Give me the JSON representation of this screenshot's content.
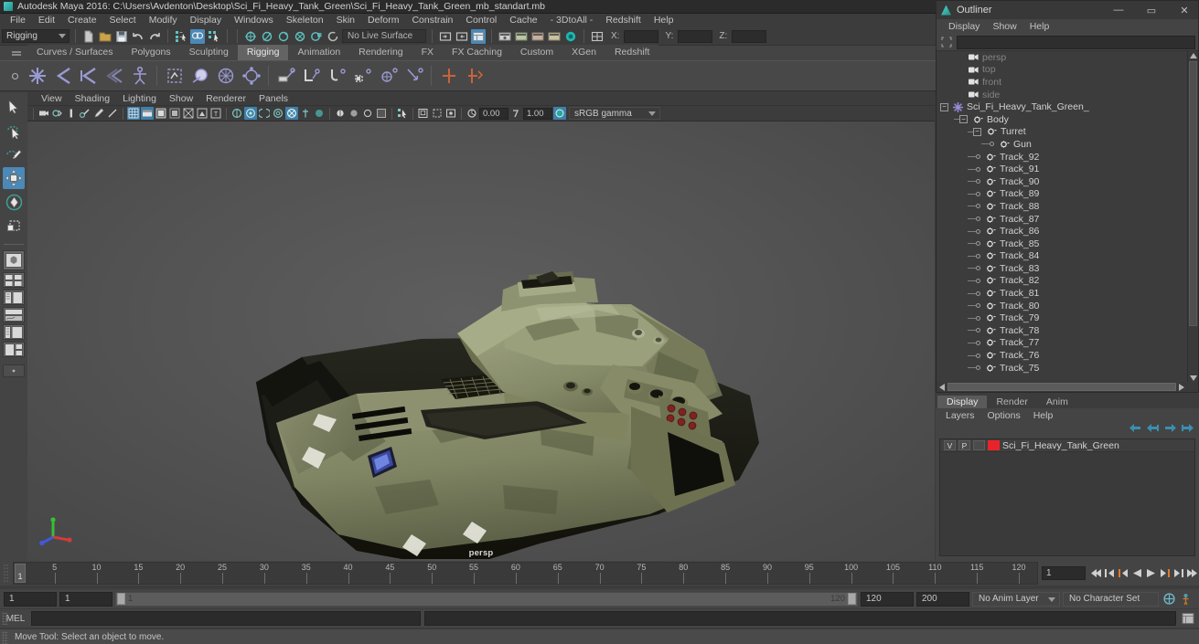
{
  "window": {
    "title": "Autodesk Maya 2016: C:\\Users\\Avdenton\\Desktop\\Sci_Fi_Heavy_Tank_Green\\Sci_Fi_Heavy_Tank_Green_mb_standart.mb",
    "app_icon": "maya-icon"
  },
  "menubar": {
    "items": [
      {
        "label": "File"
      },
      {
        "label": "Edit"
      },
      {
        "label": "Create"
      },
      {
        "label": "Select"
      },
      {
        "label": "Modify"
      },
      {
        "label": "Display"
      },
      {
        "label": "Windows"
      },
      {
        "label": "Skeleton"
      },
      {
        "label": "Skin"
      },
      {
        "label": "Deform"
      },
      {
        "label": "Constrain"
      },
      {
        "label": "Control"
      },
      {
        "label": "Cache"
      },
      {
        "label": "- 3DtoAll -"
      },
      {
        "label": "Redshift"
      },
      {
        "label": "Help"
      }
    ]
  },
  "statusline": {
    "mode_menu": "Rigging",
    "no_live_surface": "No Live Surface",
    "coord_x_label": "X:",
    "coord_y_label": "Y:",
    "coord_z_label": "Z:",
    "coord_x_value": "",
    "coord_y_value": "",
    "coord_z_value": ""
  },
  "shelf": {
    "tabs": [
      {
        "label": "Curves / Surfaces",
        "selected": false
      },
      {
        "label": "Polygons",
        "selected": false
      },
      {
        "label": "Sculpting",
        "selected": false
      },
      {
        "label": "Rigging",
        "selected": true
      },
      {
        "label": "Animation",
        "selected": false
      },
      {
        "label": "Rendering",
        "selected": false
      },
      {
        "label": "FX",
        "selected": false
      },
      {
        "label": "FX Caching",
        "selected": false
      },
      {
        "label": "Custom",
        "selected": false
      },
      {
        "label": "XGen",
        "selected": false
      },
      {
        "label": "Redshift",
        "selected": false
      }
    ]
  },
  "viewport": {
    "menu": [
      {
        "label": "View"
      },
      {
        "label": "Shading"
      },
      {
        "label": "Lighting"
      },
      {
        "label": "Show"
      },
      {
        "label": "Renderer"
      },
      {
        "label": "Panels"
      }
    ],
    "exposure_value": "0.00",
    "gamma_value": "1.00",
    "color_management": "sRGB gamma",
    "camera_label": "persp",
    "model_name": "Sci-Fi Heavy Tank (Green)"
  },
  "outliner": {
    "title": "Outliner",
    "menu": [
      {
        "label": "Display"
      },
      {
        "label": "Show"
      },
      {
        "label": "Help"
      }
    ],
    "search_value": "",
    "minimize_glyph": "—",
    "maximize_glyph": "▭",
    "close_glyph": "✕",
    "items": [
      {
        "label": "persp",
        "type": "camera",
        "depth": 1,
        "dim": true,
        "node": "leaf-none"
      },
      {
        "label": "top",
        "type": "camera",
        "depth": 1,
        "dim": true,
        "node": "leaf-none"
      },
      {
        "label": "front",
        "type": "camera",
        "depth": 1,
        "dim": true,
        "node": "leaf-none"
      },
      {
        "label": "side",
        "type": "camera",
        "depth": 1,
        "dim": true,
        "node": "leaf-none"
      },
      {
        "label": "Sci_Fi_Heavy_Tank_Green_",
        "type": "group",
        "depth": 0,
        "dim": false,
        "node": "minus"
      },
      {
        "label": "Body",
        "type": "transform",
        "depth": 1,
        "dim": false,
        "node": "minus"
      },
      {
        "label": "Turret",
        "type": "transform",
        "depth": 2,
        "dim": false,
        "node": "minus"
      },
      {
        "label": "Gun",
        "type": "transform",
        "depth": 3,
        "dim": false,
        "node": "leaf"
      },
      {
        "label": "Track_92",
        "type": "transform",
        "depth": 2,
        "dim": false,
        "node": "leaf"
      },
      {
        "label": "Track_91",
        "type": "transform",
        "depth": 2,
        "dim": false,
        "node": "leaf"
      },
      {
        "label": "Track_90",
        "type": "transform",
        "depth": 2,
        "dim": false,
        "node": "leaf"
      },
      {
        "label": "Track_89",
        "type": "transform",
        "depth": 2,
        "dim": false,
        "node": "leaf"
      },
      {
        "label": "Track_88",
        "type": "transform",
        "depth": 2,
        "dim": false,
        "node": "leaf"
      },
      {
        "label": "Track_87",
        "type": "transform",
        "depth": 2,
        "dim": false,
        "node": "leaf"
      },
      {
        "label": "Track_86",
        "type": "transform",
        "depth": 2,
        "dim": false,
        "node": "leaf"
      },
      {
        "label": "Track_85",
        "type": "transform",
        "depth": 2,
        "dim": false,
        "node": "leaf"
      },
      {
        "label": "Track_84",
        "type": "transform",
        "depth": 2,
        "dim": false,
        "node": "leaf"
      },
      {
        "label": "Track_83",
        "type": "transform",
        "depth": 2,
        "dim": false,
        "node": "leaf"
      },
      {
        "label": "Track_82",
        "type": "transform",
        "depth": 2,
        "dim": false,
        "node": "leaf"
      },
      {
        "label": "Track_81",
        "type": "transform",
        "depth": 2,
        "dim": false,
        "node": "leaf"
      },
      {
        "label": "Track_80",
        "type": "transform",
        "depth": 2,
        "dim": false,
        "node": "leaf"
      },
      {
        "label": "Track_79",
        "type": "transform",
        "depth": 2,
        "dim": false,
        "node": "leaf"
      },
      {
        "label": "Track_78",
        "type": "transform",
        "depth": 2,
        "dim": false,
        "node": "leaf"
      },
      {
        "label": "Track_77",
        "type": "transform",
        "depth": 2,
        "dim": false,
        "node": "leaf"
      },
      {
        "label": "Track_76",
        "type": "transform",
        "depth": 2,
        "dim": false,
        "node": "leaf"
      },
      {
        "label": "Track_75",
        "type": "transform",
        "depth": 2,
        "dim": false,
        "node": "leaf"
      }
    ]
  },
  "layer_editor": {
    "tabs": [
      {
        "label": "Display",
        "selected": true
      },
      {
        "label": "Render",
        "selected": false
      },
      {
        "label": "Anim",
        "selected": false
      }
    ],
    "menu": [
      {
        "label": "Layers"
      },
      {
        "label": "Options"
      },
      {
        "label": "Help"
      }
    ],
    "layers": [
      {
        "visibility": "V",
        "playback": "P",
        "type": "",
        "color": "#e8242a",
        "name": "Sci_Fi_Heavy_Tank_Green"
      }
    ]
  },
  "timeslider": {
    "current_frame": "1",
    "tick_labels": [
      "5",
      "10",
      "15",
      "20",
      "25",
      "30",
      "35",
      "40",
      "45",
      "50",
      "55",
      "60",
      "65",
      "70",
      "75",
      "80",
      "85",
      "90",
      "95",
      "100",
      "105",
      "110",
      "115",
      "120"
    ],
    "tick_values": [
      5,
      10,
      15,
      20,
      25,
      30,
      35,
      40,
      45,
      50,
      55,
      60,
      65,
      70,
      75,
      80,
      85,
      90,
      95,
      100,
      105,
      110,
      115,
      120
    ],
    "range_start": 1,
    "range_end": 120,
    "frame_field": "1"
  },
  "rangeslider": {
    "anim_start": "1",
    "range_start": "1",
    "bar_left_label": "1",
    "bar_right_label": "120",
    "range_end": "120",
    "anim_end": "200",
    "anim_layer": "No Anim Layer",
    "character_set": "No Character Set"
  },
  "commandline": {
    "label": "MEL",
    "input_value": "",
    "output_value": ""
  },
  "helpline": {
    "message": "Move Tool: Select an object to move."
  },
  "toolbox": {
    "tools": [
      {
        "name": "select-tool",
        "active": false
      },
      {
        "name": "lasso-tool",
        "active": false
      },
      {
        "name": "paint-select-tool",
        "active": false
      },
      {
        "name": "move-tool",
        "active": true
      },
      {
        "name": "rotate-tool",
        "active": false
      },
      {
        "name": "scale-tool",
        "active": false
      }
    ]
  },
  "colors": {
    "accent": "#4a89b8",
    "shelf_icon": "#9a9ad4",
    "layer_color": "#e8242a",
    "background": "#444444",
    "panel": "#3c3c3c"
  }
}
